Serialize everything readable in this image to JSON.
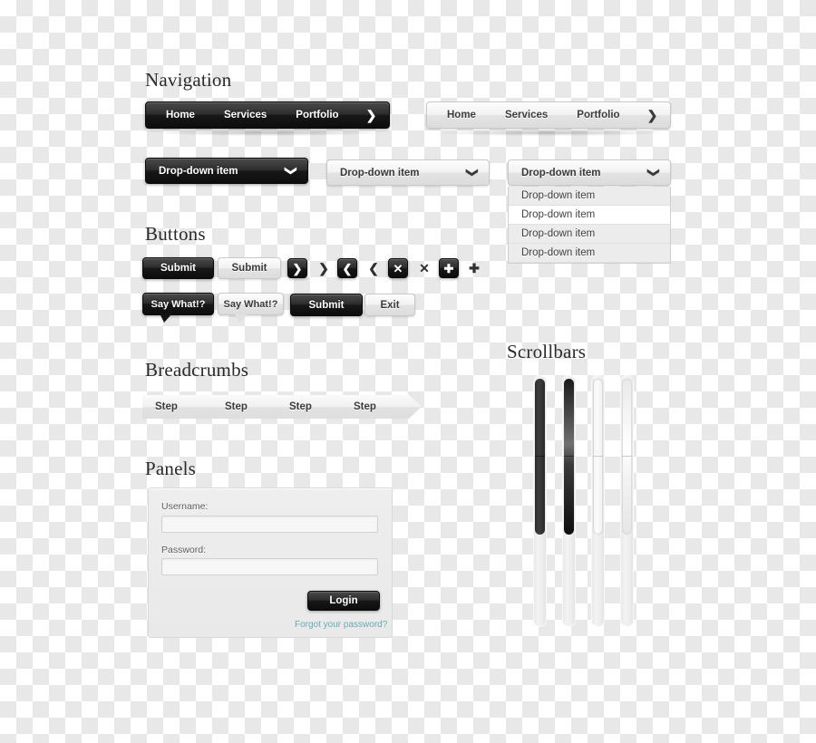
{
  "sections": {
    "navigation": "Navigation",
    "buttons": "Buttons",
    "breadcrumbs": "Breadcrumbs",
    "panels": "Panels",
    "scrollbars": "Scrollbars"
  },
  "navbar_dark": {
    "items": [
      "Home",
      "Services",
      "Portfolio"
    ],
    "arrow": "❯"
  },
  "navbar_light": {
    "items": [
      "Home",
      "Services",
      "Portfolio"
    ],
    "arrow": "❯"
  },
  "dropdowns": {
    "dark_label": "Drop-down item",
    "light_label": "Drop-down item",
    "open_label": "Drop-down item",
    "caret": "❯",
    "options": [
      {
        "label": "Drop-down item",
        "hovered": false
      },
      {
        "label": "Drop-down item",
        "hovered": true
      },
      {
        "label": "Drop-down item",
        "hovered": false
      },
      {
        "label": "Drop-down item",
        "hovered": false
      }
    ]
  },
  "buttons": {
    "submit_dark": "Submit",
    "submit_light": "Submit",
    "submit_wide": "Submit",
    "exit": "Exit",
    "bubble_dark": "Say What!?",
    "bubble_light": "Say What!?",
    "icons": [
      {
        "name": "chevron-right-icon",
        "glyph": "❯",
        "style": "dark-box"
      },
      {
        "name": "chevron-right-icon",
        "glyph": "❯",
        "style": "plain-dark-glyph"
      },
      {
        "name": "chevron-left-icon",
        "glyph": "❮",
        "style": "dark-box"
      },
      {
        "name": "chevron-left-icon",
        "glyph": "❮",
        "style": "plain-dark-glyph"
      },
      {
        "name": "close-x-icon",
        "glyph": "✕",
        "style": "dark-box"
      },
      {
        "name": "close-x-icon",
        "glyph": "✕",
        "style": "plain-dark-glyph"
      },
      {
        "name": "plus-icon",
        "glyph": "✚",
        "style": "dark-box"
      },
      {
        "name": "plus-icon",
        "glyph": "✚",
        "style": "plain-dark-glyph"
      }
    ]
  },
  "breadcrumbs": {
    "steps": [
      "Step",
      "Step",
      "Step",
      "Step"
    ]
  },
  "panel": {
    "username_label": "Username:",
    "username_value": "",
    "username_placeholder": "",
    "password_label": "Password:",
    "password_value": "",
    "password_placeholder": "",
    "login_button": "Login",
    "forgot_link": "Forgot your password?"
  },
  "scrollbars": {
    "bars": [
      {
        "name": "scrollbar-dark-flat",
        "thumb": "dark-flat"
      },
      {
        "name": "scrollbar-dark-gradient",
        "thumb": "dark-grad"
      },
      {
        "name": "scrollbar-light-flat",
        "thumb": "light-flat"
      },
      {
        "name": "scrollbar-light-gradient",
        "thumb": "light-grad"
      }
    ]
  },
  "colors": {
    "dark": "#141414",
    "light": "#ececec",
    "link": "#6aa9b4",
    "text_dark": "#2a2a2a"
  }
}
